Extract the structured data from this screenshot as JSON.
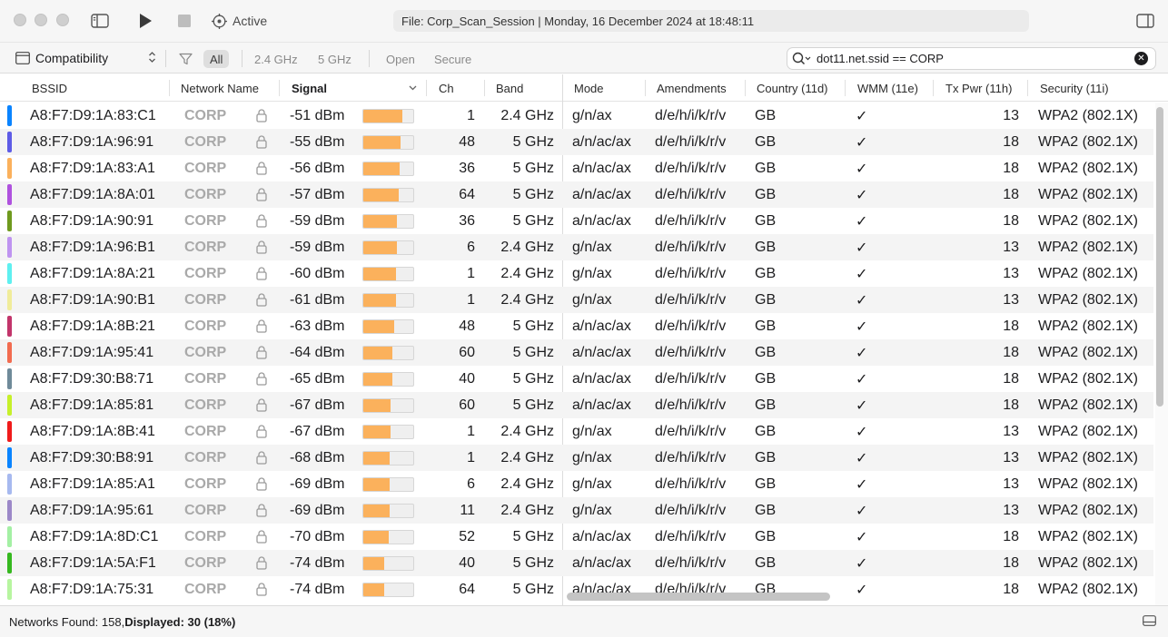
{
  "titlebar": {
    "status": "Active",
    "file_info": "File: Corp_Scan_Session | Monday, 16 December 2024 at 18:48:11"
  },
  "toolbar": {
    "view_select": "Compatibility",
    "filters": [
      "All",
      "2.4 GHz",
      "5 GHz"
    ],
    "security_filters": [
      "Open",
      "Secure"
    ],
    "selected_filter": "All",
    "search_query": "dot11.net.ssid == CORP"
  },
  "columns": {
    "bssid": "BSSID",
    "network_name": "Network Name",
    "signal": "Signal",
    "ch": "Ch",
    "band": "Band",
    "mode": "Mode",
    "amendments": "Amendments",
    "country": "Country (11d)",
    "wmm": "WMM (11e)",
    "tx_pwr": "Tx Pwr (11h)",
    "security": "Security (11i)"
  },
  "rows": [
    {
      "color": "#0a84ff",
      "bssid": "A8:F7:D9:1A:83:C1",
      "name": "CORP",
      "signal": "-51 dBm",
      "signal_pct": 78,
      "ch": "1",
      "band": "2.4 GHz",
      "mode": "g/n/ax",
      "amend": "d/e/h/i/k/r/v",
      "country": "GB",
      "wmm": "✓",
      "tx": "13",
      "sec": "WPA2 (802.1X)"
    },
    {
      "color": "#5e5ce6",
      "bssid": "A8:F7:D9:1A:96:91",
      "name": "CORP",
      "signal": "-55 dBm",
      "signal_pct": 74,
      "ch": "48",
      "band": "5 GHz",
      "mode": "a/n/ac/ax",
      "amend": "d/e/h/i/k/r/v",
      "country": "GB",
      "wmm": "✓",
      "tx": "18",
      "sec": "WPA2 (802.1X)"
    },
    {
      "color": "#fbb15c",
      "bssid": "A8:F7:D9:1A:83:A1",
      "name": "CORP",
      "signal": "-56 dBm",
      "signal_pct": 72,
      "ch": "36",
      "band": "5 GHz",
      "mode": "a/n/ac/ax",
      "amend": "d/e/h/i/k/r/v",
      "country": "GB",
      "wmm": "✓",
      "tx": "18",
      "sec": "WPA2 (802.1X)"
    },
    {
      "color": "#af52de",
      "bssid": "A8:F7:D9:1A:8A:01",
      "name": "CORP",
      "signal": "-57 dBm",
      "signal_pct": 71,
      "ch": "64",
      "band": "5 GHz",
      "mode": "a/n/ac/ax",
      "amend": "d/e/h/i/k/r/v",
      "country": "GB",
      "wmm": "✓",
      "tx": "18",
      "sec": "WPA2 (802.1X)"
    },
    {
      "color": "#6f9a1e",
      "bssid": "A8:F7:D9:1A:90:91",
      "name": "CORP",
      "signal": "-59 dBm",
      "signal_pct": 68,
      "ch": "36",
      "band": "5 GHz",
      "mode": "a/n/ac/ax",
      "amend": "d/e/h/i/k/r/v",
      "country": "GB",
      "wmm": "✓",
      "tx": "18",
      "sec": "WPA2 (802.1X)"
    },
    {
      "color": "#bf94f0",
      "bssid": "A8:F7:D9:1A:96:B1",
      "name": "CORP",
      "signal": "-59 dBm",
      "signal_pct": 68,
      "ch": "6",
      "band": "2.4 GHz",
      "mode": "g/n/ax",
      "amend": "d/e/h/i/k/r/v",
      "country": "GB",
      "wmm": "✓",
      "tx": "13",
      "sec": "WPA2 (802.1X)"
    },
    {
      "color": "#5ef0f0",
      "bssid": "A8:F7:D9:1A:8A:21",
      "name": "CORP",
      "signal": "-60 dBm",
      "signal_pct": 66,
      "ch": "1",
      "band": "2.4 GHz",
      "mode": "g/n/ax",
      "amend": "d/e/h/i/k/r/v",
      "country": "GB",
      "wmm": "✓",
      "tx": "13",
      "sec": "WPA2 (802.1X)"
    },
    {
      "color": "#f0ec9a",
      "bssid": "A8:F7:D9:1A:90:B1",
      "name": "CORP",
      "signal": "-61 dBm",
      "signal_pct": 65,
      "ch": "1",
      "band": "2.4 GHz",
      "mode": "g/n/ax",
      "amend": "d/e/h/i/k/r/v",
      "country": "GB",
      "wmm": "✓",
      "tx": "13",
      "sec": "WPA2 (802.1X)"
    },
    {
      "color": "#c2356b",
      "bssid": "A8:F7:D9:1A:8B:21",
      "name": "CORP",
      "signal": "-63 dBm",
      "signal_pct": 61,
      "ch": "48",
      "band": "5 GHz",
      "mode": "a/n/ac/ax",
      "amend": "d/e/h/i/k/r/v",
      "country": "GB",
      "wmm": "✓",
      "tx": "18",
      "sec": "WPA2 (802.1X)"
    },
    {
      "color": "#f26b4f",
      "bssid": "A8:F7:D9:1A:95:41",
      "name": "CORP",
      "signal": "-64 dBm",
      "signal_pct": 59,
      "ch": "60",
      "band": "5 GHz",
      "mode": "a/n/ac/ax",
      "amend": "d/e/h/i/k/r/v",
      "country": "GB",
      "wmm": "✓",
      "tx": "18",
      "sec": "WPA2 (802.1X)"
    },
    {
      "color": "#6f8a99",
      "bssid": "A8:F7:D9:30:B8:71",
      "name": "CORP",
      "signal": "-65 dBm",
      "signal_pct": 58,
      "ch": "40",
      "band": "5 GHz",
      "mode": "a/n/ac/ax",
      "amend": "d/e/h/i/k/r/v",
      "country": "GB",
      "wmm": "✓",
      "tx": "18",
      "sec": "WPA2 (802.1X)"
    },
    {
      "color": "#c6f02a",
      "bssid": "A8:F7:D9:1A:85:81",
      "name": "CORP",
      "signal": "-67 dBm",
      "signal_pct": 55,
      "ch": "60",
      "band": "5 GHz",
      "mode": "a/n/ac/ax",
      "amend": "d/e/h/i/k/r/v",
      "country": "GB",
      "wmm": "✓",
      "tx": "18",
      "sec": "WPA2 (802.1X)"
    },
    {
      "color": "#f01b1b",
      "bssid": "A8:F7:D9:1A:8B:41",
      "name": "CORP",
      "signal": "-67 dBm",
      "signal_pct": 55,
      "ch": "1",
      "band": "2.4 GHz",
      "mode": "g/n/ax",
      "amend": "d/e/h/i/k/r/v",
      "country": "GB",
      "wmm": "✓",
      "tx": "13",
      "sec": "WPA2 (802.1X)"
    },
    {
      "color": "#0a84ff",
      "bssid": "A8:F7:D9:30:B8:91",
      "name": "CORP",
      "signal": "-68 dBm",
      "signal_pct": 53,
      "ch": "1",
      "band": "2.4 GHz",
      "mode": "g/n/ax",
      "amend": "d/e/h/i/k/r/v",
      "country": "GB",
      "wmm": "✓",
      "tx": "13",
      "sec": "WPA2 (802.1X)"
    },
    {
      "color": "#a7b9ef",
      "bssid": "A8:F7:D9:1A:85:A1",
      "name": "CORP",
      "signal": "-69 dBm",
      "signal_pct": 52,
      "ch": "6",
      "band": "2.4 GHz",
      "mode": "g/n/ax",
      "amend": "d/e/h/i/k/r/v",
      "country": "GB",
      "wmm": "✓",
      "tx": "13",
      "sec": "WPA2 (802.1X)"
    },
    {
      "color": "#9c88c8",
      "bssid": "A8:F7:D9:1A:95:61",
      "name": "CORP",
      "signal": "-69 dBm",
      "signal_pct": 52,
      "ch": "11",
      "band": "2.4 GHz",
      "mode": "g/n/ax",
      "amend": "d/e/h/i/k/r/v",
      "country": "GB",
      "wmm": "✓",
      "tx": "13",
      "sec": "WPA2 (802.1X)"
    },
    {
      "color": "#a4f0a4",
      "bssid": "A8:F7:D9:1A:8D:C1",
      "name": "CORP",
      "signal": "-70 dBm",
      "signal_pct": 50,
      "ch": "52",
      "band": "5 GHz",
      "mode": "a/n/ac/ax",
      "amend": "d/e/h/i/k/r/v",
      "country": "GB",
      "wmm": "✓",
      "tx": "18",
      "sec": "WPA2 (802.1X)"
    },
    {
      "color": "#36b81f",
      "bssid": "A8:F7:D9:1A:5A:F1",
      "name": "CORP",
      "signal": "-74 dBm",
      "signal_pct": 42,
      "ch": "40",
      "band": "5 GHz",
      "mode": "a/n/ac/ax",
      "amend": "d/e/h/i/k/r/v",
      "country": "GB",
      "wmm": "✓",
      "tx": "18",
      "sec": "WPA2 (802.1X)"
    },
    {
      "color": "#b7f5a0",
      "bssid": "A8:F7:D9:1A:75:31",
      "name": "CORP",
      "signal": "-74 dBm",
      "signal_pct": 42,
      "ch": "64",
      "band": "5 GHz",
      "mode": "a/n/ac/ax",
      "amend": "d/e/h/i/k/r/v",
      "country": "GB",
      "wmm": "✓",
      "tx": "18",
      "sec": "WPA2 (802.1X)"
    }
  ],
  "status": {
    "found_label": "Networks Found: 158, ",
    "displayed_label": "Displayed: 30 (18%)"
  }
}
